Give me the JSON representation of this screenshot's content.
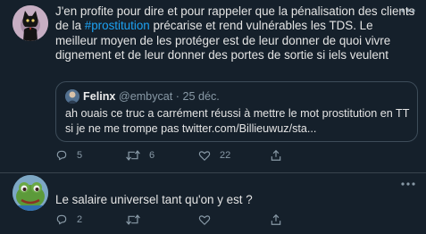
{
  "tweets": [
    {
      "text_before": "J'en profite pour dire et pour rappeler que la pénalisation des clients de la ",
      "hashtag": "#prostitution",
      "text_after": " précarise et rend vulnérables les TDS. Le meilleur moyen de les protéger est de leur donner de quoi vivre dignement et de leur donner des portes de sortie si iels veulent",
      "quote": {
        "name": "Felinx",
        "handle": "@embycat",
        "separator": "·",
        "date": "25 déc.",
        "text": "ah ouais ce truc a carrément réussi à mettre le mot prostitution en TT si je ne me trompe pas twitter.com/Billieuwuz/sta..."
      },
      "counts": {
        "reply": "5",
        "retweet": "6",
        "like": "22"
      }
    },
    {
      "text": "Le salaire universel tant qu'on y est ?",
      "counts": {
        "reply": "2"
      }
    }
  ],
  "colors": {
    "background": "#15202b",
    "text": "#d9d9d9",
    "muted": "#8899a6",
    "accent": "#1da1f2",
    "border": "#38444d"
  },
  "icons": [
    "cat-avatar",
    "frog-avatar",
    "more-icon",
    "reply-icon",
    "retweet-icon",
    "like-icon",
    "share-icon"
  ]
}
